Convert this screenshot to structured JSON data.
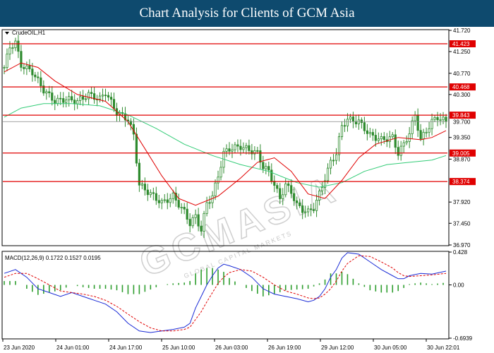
{
  "header": {
    "title": "Chart Analysis for Clients of GCM Asia"
  },
  "watermark": {
    "brand": "GCMASIA",
    "tagline": "GLOBAL CAPITAL MARKETS"
  },
  "colors": {
    "background": "#ffffff",
    "title_bar": "#0e4a6e",
    "level_line": "#e00000",
    "ma_fast": "#e00000",
    "ma_slow": "#33cc77",
    "macd_line": "#1a2bd6",
    "signal_line": "#e00000",
    "histogram": "#2e9e2e",
    "candle": "#2e8b2e"
  },
  "chart_data": [
    {
      "type": "candlestick",
      "symbol_label": "CrudeOIL,H1",
      "timeframe": "H1",
      "ylim": [
        36.97,
        41.72
      ],
      "y_ticks": [
        "41.720",
        "41.250",
        "40.770",
        "40.300",
        "39.350",
        "38.870",
        "37.920",
        "37.450",
        "36.970"
      ],
      "x_labels": [
        "23 Jun 2020",
        "24 Jun 01:00",
        "24 Jun 17:00",
        "25 Jun 10:00",
        "26 Jun 03:00",
        "26 Jun 19:00",
        "29 Jun 12:00",
        "30 Jun 05:00",
        "30 Jun 22:01"
      ],
      "current_price": "39.700",
      "levels": [
        {
          "value": 41.423,
          "label": "41.423"
        },
        {
          "value": 40.468,
          "label": "40.468"
        },
        {
          "value": 39.843,
          "label": "39.843"
        },
        {
          "value": 39.005,
          "label": "39.005"
        },
        {
          "value": 38.374,
          "label": "38.374"
        }
      ],
      "close_path": [
        [
          0,
          40.9
        ],
        [
          2,
          41.35
        ],
        [
          4,
          41.45
        ],
        [
          6,
          40.95
        ],
        [
          10,
          40.8
        ],
        [
          14,
          40.4
        ],
        [
          18,
          40.15
        ],
        [
          22,
          40.2
        ],
        [
          26,
          40.15
        ],
        [
          30,
          40.3
        ],
        [
          34,
          40.2
        ],
        [
          36,
          40.35
        ],
        [
          40,
          39.9
        ],
        [
          44,
          39.75
        ],
        [
          46,
          39.4
        ],
        [
          48,
          38.3
        ],
        [
          52,
          38.1
        ],
        [
          56,
          37.9
        ],
        [
          60,
          38.05
        ],
        [
          64,
          37.7
        ],
        [
          66,
          37.45
        ],
        [
          68,
          37.6
        ],
        [
          70,
          37.3
        ],
        [
          72,
          37.9
        ],
        [
          74,
          38.05
        ],
        [
          76,
          38.5
        ],
        [
          78,
          39.0
        ],
        [
          80,
          39.1
        ],
        [
          84,
          39.15
        ],
        [
          88,
          39.05
        ],
        [
          90,
          39.0
        ],
        [
          92,
          38.7
        ],
        [
          94,
          38.6
        ],
        [
          96,
          38.3
        ],
        [
          98,
          38.0
        ],
        [
          100,
          38.3
        ],
        [
          102,
          38.15
        ],
        [
          104,
          37.85
        ],
        [
          106,
          37.75
        ],
        [
          108,
          37.7
        ],
        [
          110,
          37.8
        ],
        [
          112,
          38.1
        ],
        [
          114,
          38.45
        ],
        [
          116,
          38.8
        ],
        [
          118,
          39.0
        ],
        [
          120,
          39.6
        ],
        [
          122,
          39.75
        ],
        [
          126,
          39.7
        ],
        [
          130,
          39.4
        ],
        [
          134,
          39.3
        ],
        [
          138,
          39.35
        ],
        [
          140,
          39.0
        ],
        [
          142,
          39.2
        ],
        [
          144,
          39.45
        ],
        [
          146,
          39.85
        ],
        [
          148,
          39.3
        ],
        [
          150,
          39.5
        ],
        [
          152,
          39.7
        ],
        [
          154,
          39.8
        ],
        [
          157,
          39.7
        ]
      ],
      "ma_fast": [
        [
          0,
          40.8
        ],
        [
          6,
          41.0
        ],
        [
          12,
          40.9
        ],
        [
          18,
          40.6
        ],
        [
          26,
          40.3
        ],
        [
          36,
          40.15
        ],
        [
          44,
          39.7
        ],
        [
          50,
          39.1
        ],
        [
          56,
          38.5
        ],
        [
          62,
          38.0
        ],
        [
          68,
          37.85
        ],
        [
          76,
          38.05
        ],
        [
          84,
          38.45
        ],
        [
          90,
          38.8
        ],
        [
          96,
          38.9
        ],
        [
          102,
          38.6
        ],
        [
          108,
          38.1
        ],
        [
          114,
          38.0
        ],
        [
          120,
          38.4
        ],
        [
          126,
          38.9
        ],
        [
          132,
          39.2
        ],
        [
          140,
          39.35
        ],
        [
          148,
          39.3
        ],
        [
          152,
          39.35
        ],
        [
          157,
          39.5
        ]
      ],
      "ma_slow": [
        [
          0,
          39.8
        ],
        [
          6,
          40.0
        ],
        [
          14,
          40.1
        ],
        [
          24,
          40.1
        ],
        [
          34,
          40.05
        ],
        [
          44,
          39.85
        ],
        [
          54,
          39.55
        ],
        [
          64,
          39.2
        ],
        [
          74,
          38.95
        ],
        [
          84,
          38.75
        ],
        [
          94,
          38.6
        ],
        [
          104,
          38.35
        ],
        [
          112,
          38.25
        ],
        [
          120,
          38.35
        ],
        [
          128,
          38.6
        ],
        [
          136,
          38.75
        ],
        [
          144,
          38.8
        ],
        [
          152,
          38.85
        ],
        [
          157,
          38.95
        ]
      ]
    },
    {
      "type": "macd",
      "label": "MACD(12,26,9)",
      "values": {
        "main": 0.1722,
        "signal": 0.1527,
        "histogram": 0.0195
      },
      "values_text": "0.1722 0.1527 0.0195",
      "ylim": [
        -0.6939,
        0.428
      ],
      "y_ticks": [
        "0.428",
        "0.00",
        "-0.6939"
      ],
      "macd_line": [
        [
          0,
          0.15
        ],
        [
          4,
          0.2
        ],
        [
          8,
          0.1
        ],
        [
          12,
          -0.05
        ],
        [
          16,
          -0.1
        ],
        [
          20,
          -0.15
        ],
        [
          24,
          -0.1
        ],
        [
          28,
          -0.15
        ],
        [
          32,
          -0.2
        ],
        [
          36,
          -0.25
        ],
        [
          40,
          -0.35
        ],
        [
          44,
          -0.5
        ],
        [
          48,
          -0.6
        ],
        [
          52,
          -0.62
        ],
        [
          56,
          -0.6
        ],
        [
          60,
          -0.58
        ],
        [
          64,
          -0.55
        ],
        [
          66,
          -0.5
        ],
        [
          68,
          -0.3
        ],
        [
          70,
          -0.15
        ],
        [
          72,
          0.0
        ],
        [
          74,
          0.12
        ],
        [
          76,
          0.22
        ],
        [
          78,
          0.27
        ],
        [
          80,
          0.25
        ],
        [
          84,
          0.2
        ],
        [
          88,
          0.1
        ],
        [
          92,
          -0.05
        ],
        [
          96,
          -0.12
        ],
        [
          100,
          -0.15
        ],
        [
          104,
          -0.18
        ],
        [
          108,
          -0.22
        ],
        [
          110,
          -0.2
        ],
        [
          112,
          -0.15
        ],
        [
          114,
          -0.05
        ],
        [
          116,
          0.1
        ],
        [
          118,
          0.2
        ],
        [
          120,
          0.35
        ],
        [
          122,
          0.42
        ],
        [
          126,
          0.4
        ],
        [
          130,
          0.3
        ],
        [
          134,
          0.2
        ],
        [
          138,
          0.12
        ],
        [
          140,
          0.08
        ],
        [
          142,
          0.08
        ],
        [
          144,
          0.12
        ],
        [
          148,
          0.15
        ],
        [
          152,
          0.14
        ],
        [
          157,
          0.18
        ]
      ],
      "signal_line": [
        [
          0,
          0.1
        ],
        [
          4,
          0.15
        ],
        [
          8,
          0.15
        ],
        [
          12,
          0.08
        ],
        [
          16,
          0.0
        ],
        [
          20,
          -0.08
        ],
        [
          24,
          -0.1
        ],
        [
          28,
          -0.12
        ],
        [
          32,
          -0.15
        ],
        [
          36,
          -0.2
        ],
        [
          40,
          -0.28
        ],
        [
          44,
          -0.38
        ],
        [
          48,
          -0.48
        ],
        [
          52,
          -0.56
        ],
        [
          56,
          -0.6
        ],
        [
          60,
          -0.6
        ],
        [
          64,
          -0.58
        ],
        [
          66,
          -0.55
        ],
        [
          68,
          -0.45
        ],
        [
          70,
          -0.35
        ],
        [
          72,
          -0.22
        ],
        [
          74,
          -0.1
        ],
        [
          76,
          0.02
        ],
        [
          78,
          0.1
        ],
        [
          80,
          0.16
        ],
        [
          84,
          0.2
        ],
        [
          88,
          0.18
        ],
        [
          92,
          0.1
        ],
        [
          96,
          0.0
        ],
        [
          100,
          -0.08
        ],
        [
          104,
          -0.12
        ],
        [
          108,
          -0.17
        ],
        [
          110,
          -0.18
        ],
        [
          112,
          -0.17
        ],
        [
          114,
          -0.12
        ],
        [
          116,
          -0.05
        ],
        [
          118,
          0.05
        ],
        [
          120,
          0.18
        ],
        [
          122,
          0.28
        ],
        [
          126,
          0.38
        ],
        [
          130,
          0.37
        ],
        [
          134,
          0.3
        ],
        [
          138,
          0.22
        ],
        [
          140,
          0.16
        ],
        [
          142,
          0.12
        ],
        [
          144,
          0.11
        ],
        [
          148,
          0.12
        ],
        [
          152,
          0.13
        ],
        [
          157,
          0.15
        ]
      ]
    }
  ]
}
